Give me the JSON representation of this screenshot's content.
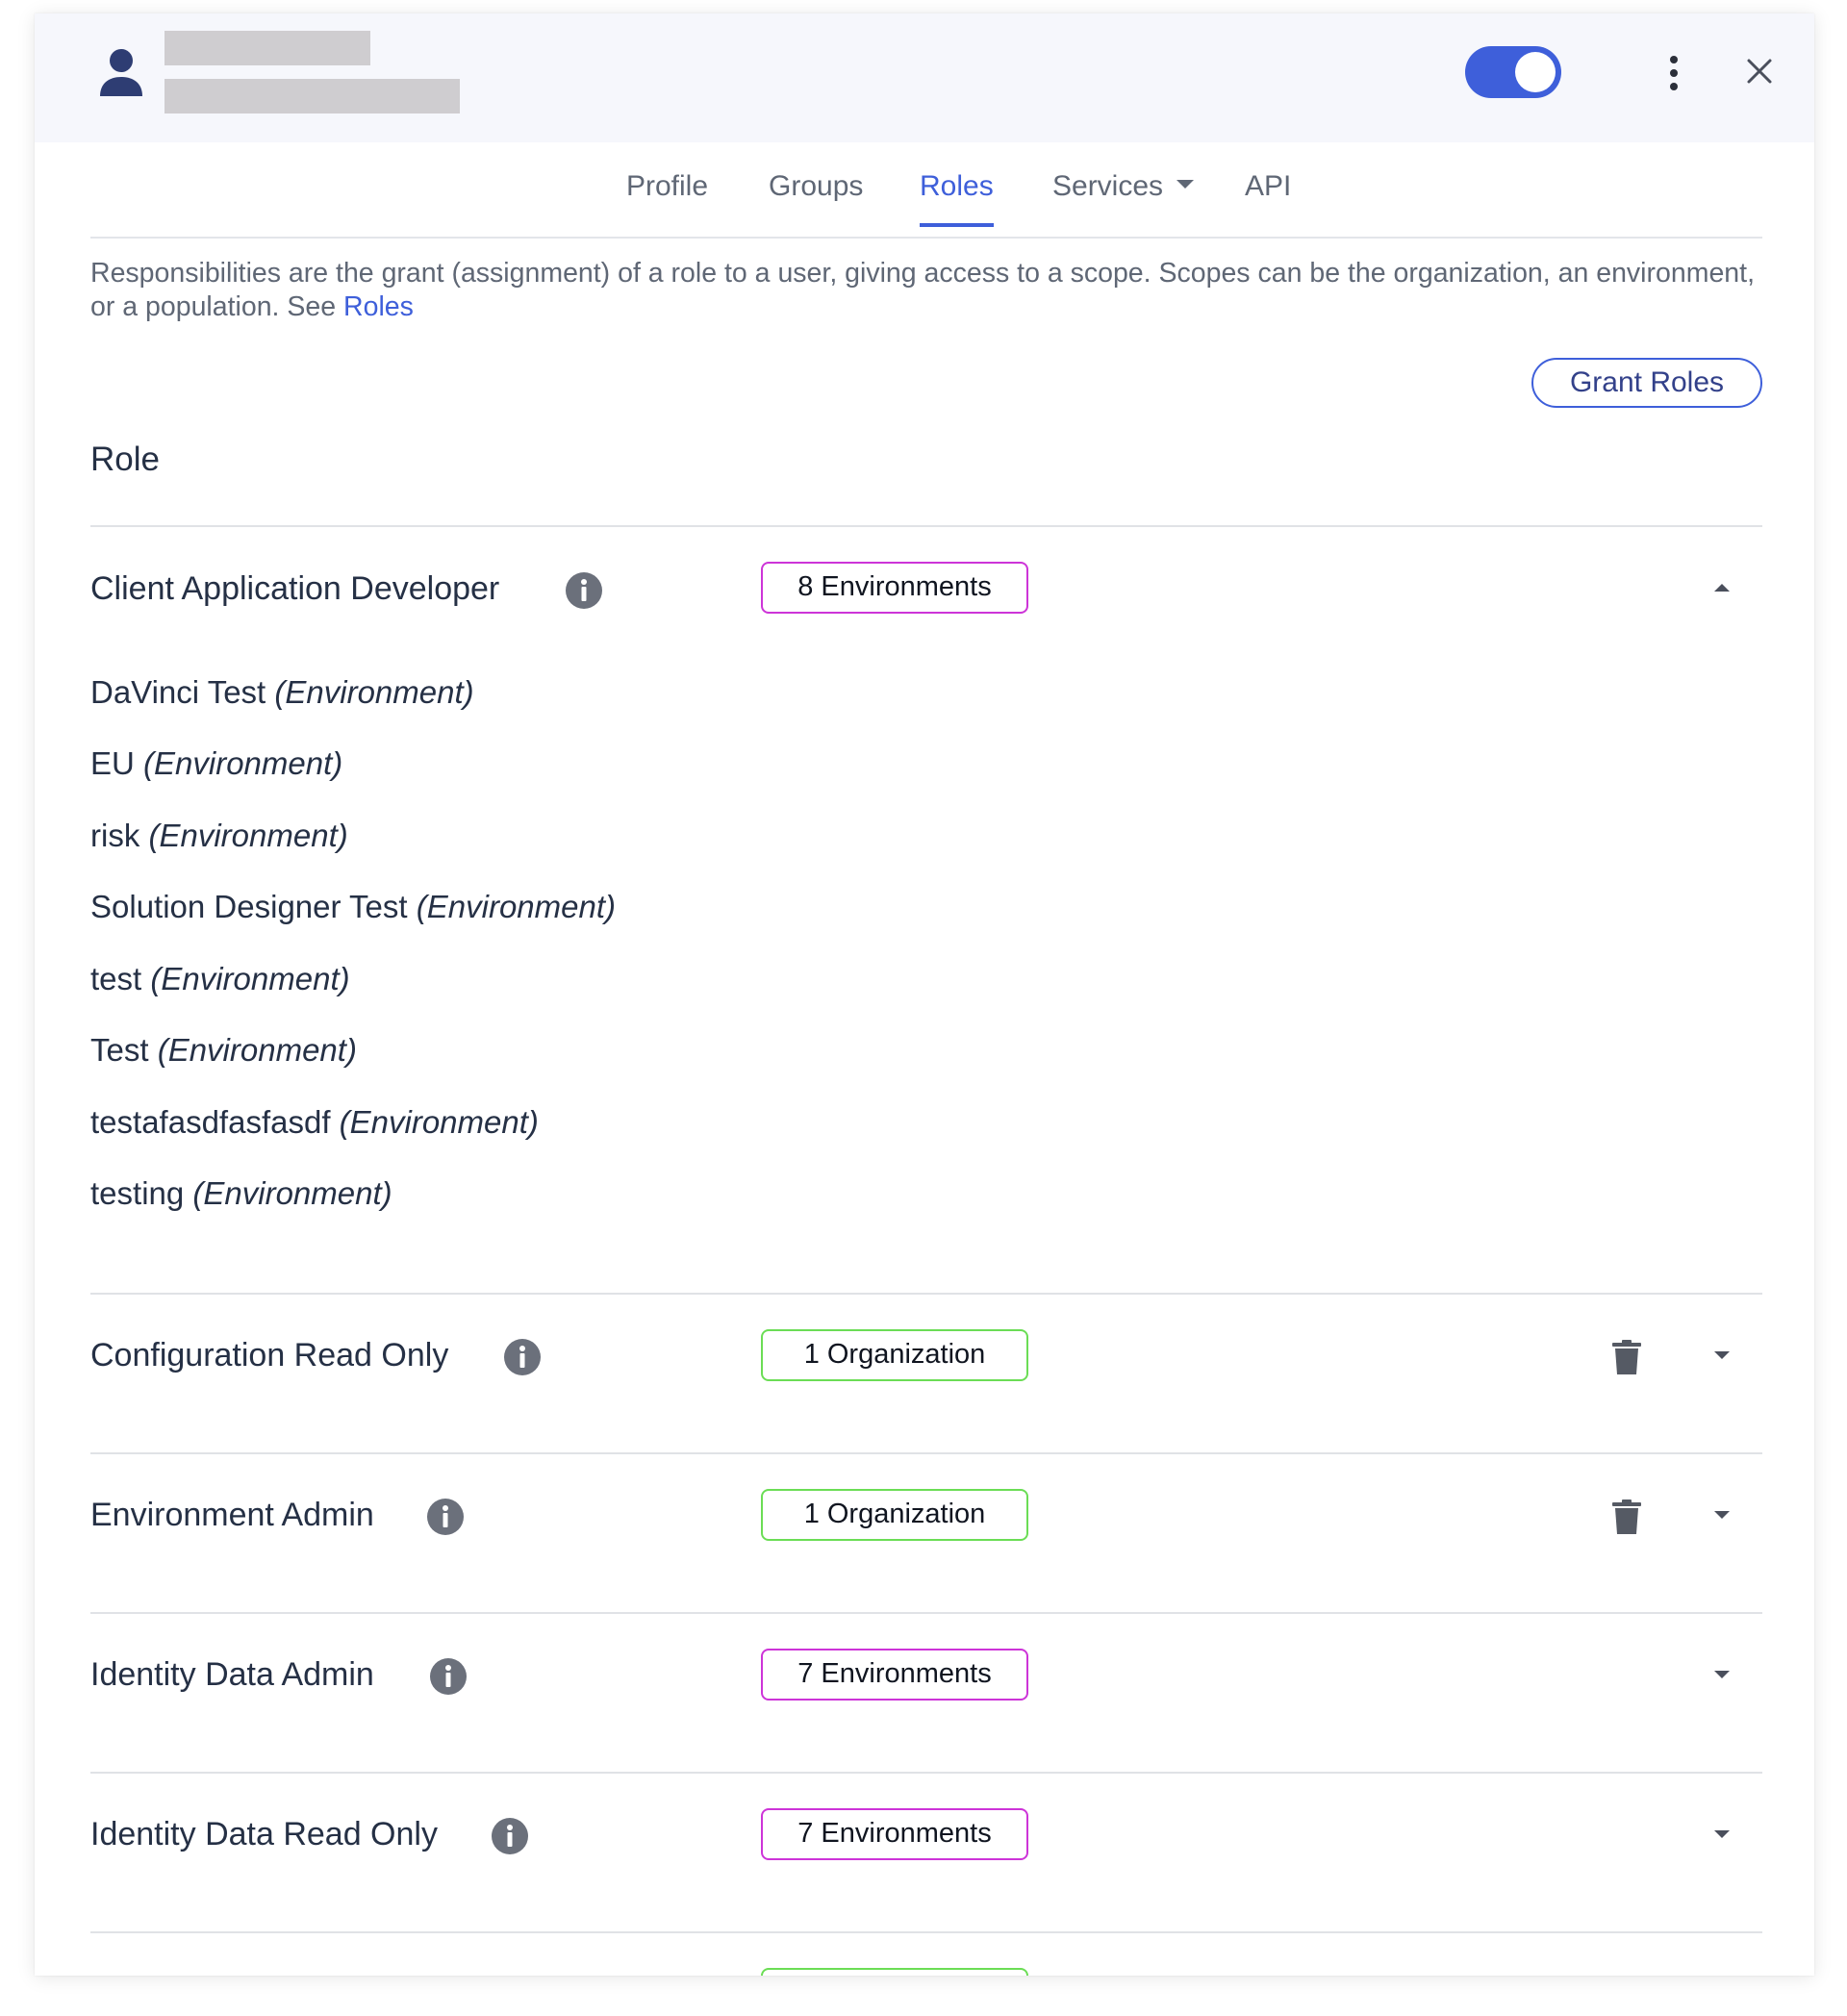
{
  "tabs": [
    {
      "label": "Profile"
    },
    {
      "label": "Groups"
    },
    {
      "label": "Roles"
    },
    {
      "label": "Services"
    },
    {
      "label": "API"
    }
  ],
  "description": {
    "text": "Responsibilities are the grant (assignment) of a role to a user, giving access to a scope. Scopes can be the organization, an environment, or a population. See",
    "link_label": "Roles"
  },
  "grant_button_label": "Grant Roles",
  "role_heading": "Role",
  "roles": [
    {
      "name": "Client Application Developer",
      "scope_badge": "8 Environments",
      "expanded": true,
      "scopes": [
        {
          "name": "DaVinci Test",
          "type": "(Environment)"
        },
        {
          "name": "EU",
          "type": "(Environment)"
        },
        {
          "name": "risk",
          "type": "(Environment)"
        },
        {
          "name": "Solution Designer Test",
          "type": "(Environment)"
        },
        {
          "name": "test",
          "type": "(Environment)"
        },
        {
          "name": "Test",
          "type": "(Environment)"
        },
        {
          "name": "testafasdfasfasdf",
          "type": "(Environment)"
        },
        {
          "name": "testing",
          "type": "(Environment)"
        }
      ]
    },
    {
      "name": "Configuration Read Only",
      "scope_badge": "1 Organization",
      "deletable": true
    },
    {
      "name": "Environment Admin",
      "scope_badge": "1 Organization",
      "deletable": true
    },
    {
      "name": "Identity Data Admin",
      "scope_badge": "7 Environments"
    },
    {
      "name": "Identity Data Read Only",
      "scope_badge": "7 Environments"
    }
  ],
  "icons": {
    "user": "user-icon",
    "toggle": "toggle-switch",
    "more": "kebab-menu-icon",
    "close": "close-icon",
    "info": "info-icon",
    "delete": "trash-icon",
    "expand": "chevron-down-icon",
    "collapse": "chevron-up-icon"
  },
  "colors": {
    "accent": "#3e5fda",
    "env_badge_border": "#cd34d8",
    "org_badge_border": "#6bdd55",
    "header_bg": "#f6f7fc"
  }
}
